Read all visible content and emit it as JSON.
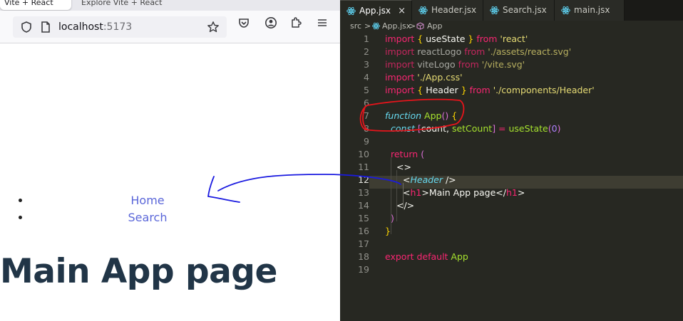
{
  "browser": {
    "tabs": [
      {
        "label": "Vite + React"
      },
      {
        "label": "Explore Vite + React"
      }
    ],
    "url": {
      "host": "localhost",
      "port": ":5173"
    },
    "nav_links": [
      {
        "label": "Home"
      },
      {
        "label": "Search"
      }
    ],
    "heading": "Main App page"
  },
  "editor": {
    "tabs": [
      {
        "label": "App.jsx",
        "active": true,
        "close": "×"
      },
      {
        "label": "Header.jsx"
      },
      {
        "label": "Search.jsx"
      },
      {
        "label": "main.jsx"
      }
    ],
    "breadcrumb": {
      "folder": "src",
      "sep": ">",
      "file": "App.jsx",
      "symbol": "App"
    },
    "line_numbers": [
      "1",
      "2",
      "3",
      "4",
      "5",
      "6",
      "7",
      "8",
      "9",
      "10",
      "11",
      "12",
      "13",
      "14",
      "15",
      "16",
      "17",
      "18",
      "19"
    ],
    "current_line": "12",
    "code": {
      "l1": {
        "kw": "import",
        "b1": "{",
        "id": " useState ",
        "b2": "}",
        "from": " from ",
        "str": "'react'"
      },
      "l2": {
        "kw": "import",
        "id": " reactLogo",
        "from": " from ",
        "str": "'./assets/react.svg'"
      },
      "l3": {
        "kw": "import",
        "id": " viteLogo",
        "from": " from ",
        "str": "'/vite.svg'"
      },
      "l4": {
        "kw": "import",
        "str": " './App.css'"
      },
      "l5": {
        "kw": "import",
        "b1": " {",
        "id": " Header ",
        "b2": "}",
        "from": " from ",
        "str": "'./components/Header'"
      },
      "l7": {
        "kw": "function",
        "fn": " App",
        "paren": "()",
        "brace": " {"
      },
      "l8": {
        "kw": "const",
        "b1": " [",
        "id1": "count",
        "comma": ", ",
        "id2": "setCount",
        "b2": "]",
        "eq": " = ",
        "fn": "useState",
        "p1": "(",
        "num": "0",
        "p2": ")"
      },
      "l10": {
        "kw": "return",
        "paren": " ("
      },
      "l11": {
        "frag": "<>"
      },
      "l12": {
        "lt": "<",
        "comp": "Header",
        "close": " />"
      },
      "l13": {
        "lt": "<",
        "tag": "h1",
        "gt": ">",
        "text": "Main App page",
        "lt2": "</",
        "tag2": "h1",
        "gt2": ">"
      },
      "l14": {
        "frag": "</>"
      },
      "l15": {
        "paren": ")"
      },
      "l16": {
        "brace": "}"
      },
      "l18": {
        "kw": "export default",
        "fn": " App"
      }
    }
  },
  "colors": {
    "annotation_red": "#e8141b",
    "annotation_blue": "#1a1ae0",
    "link_color": "#5a66d9",
    "heading_color": "#213547"
  }
}
